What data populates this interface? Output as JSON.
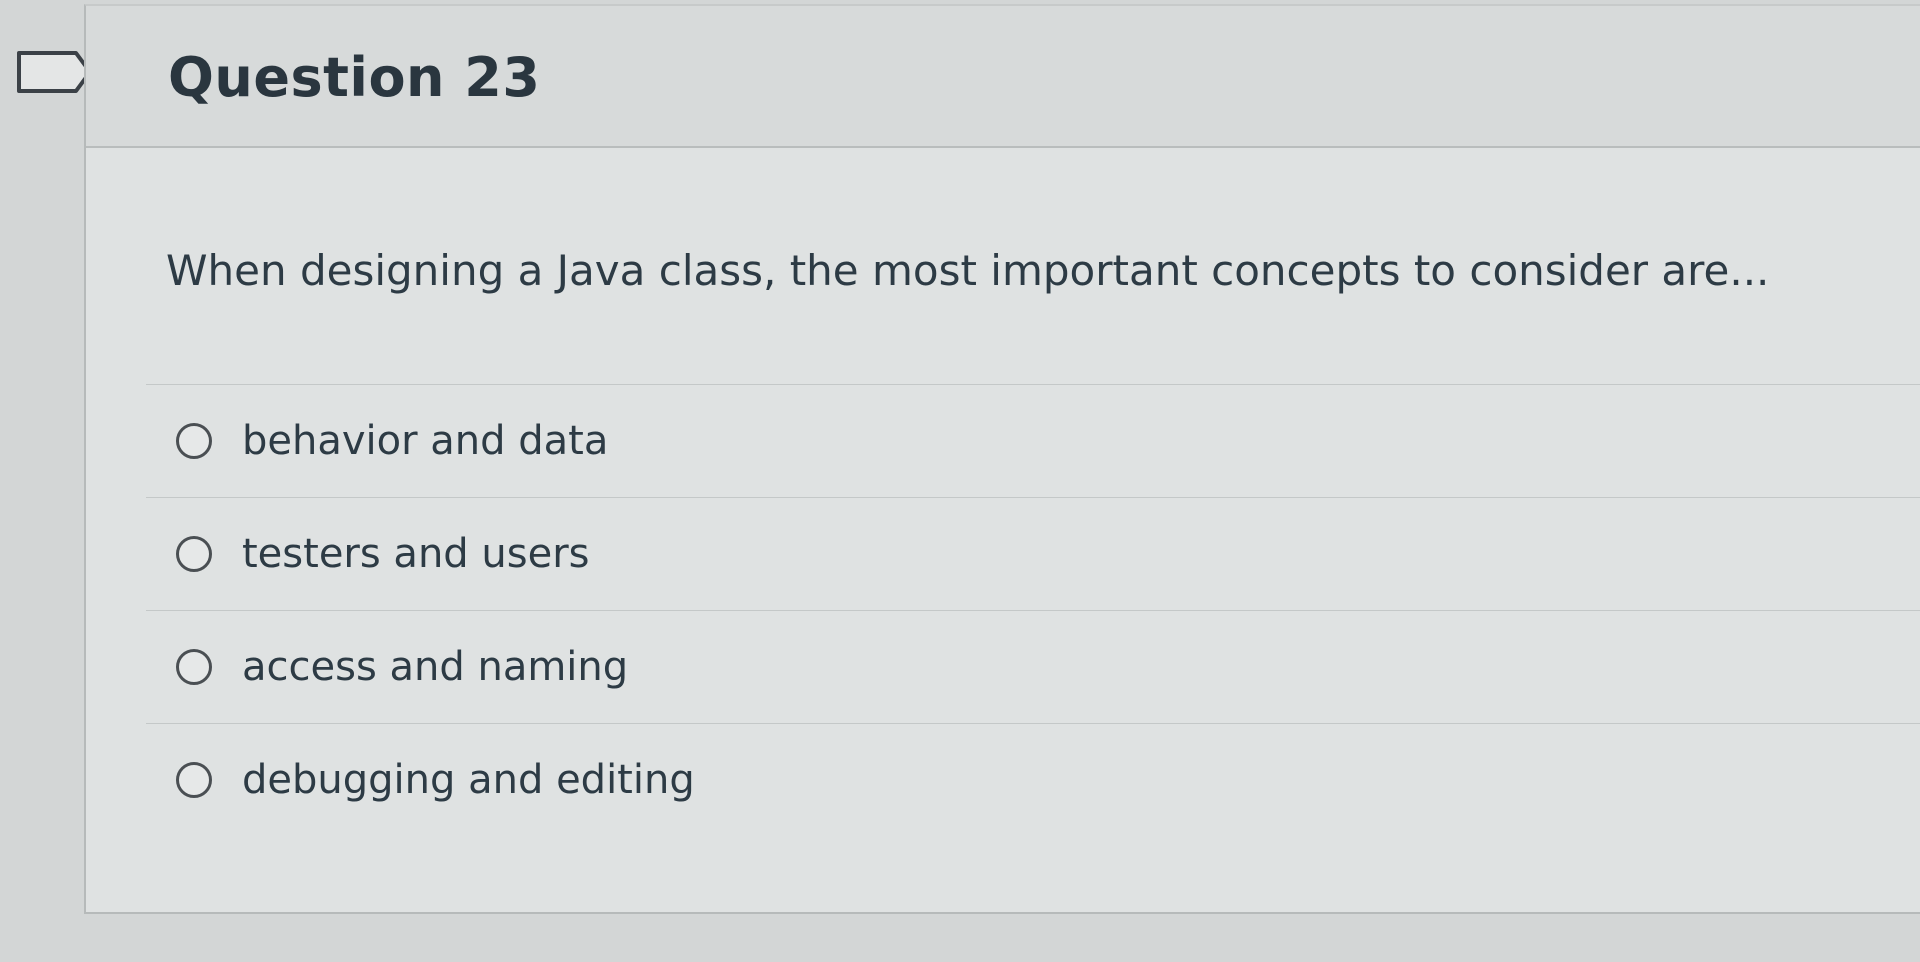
{
  "question": {
    "title": "Question 23",
    "text": "When designing a Java class, the most important concepts to consider are...",
    "answers": [
      {
        "label": "behavior and data",
        "selected": false
      },
      {
        "label": "testers and users",
        "selected": false
      },
      {
        "label": "access and naming",
        "selected": false
      },
      {
        "label": "debugging and editing",
        "selected": false
      }
    ]
  },
  "icons": {
    "flag": "bookmark-flag-icon",
    "radio": "radio-unselected-icon"
  },
  "colors": {
    "background": "#d3d6d6",
    "card": "#dfe2e2",
    "text": "#2d3b45",
    "radio_border": "#4a4f53"
  }
}
